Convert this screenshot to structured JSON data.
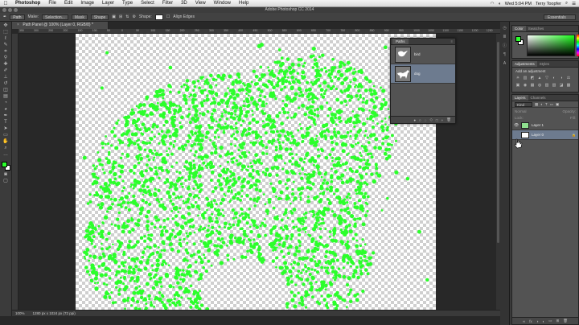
{
  "menubar": {
    "apple": "",
    "app": "Photoshop",
    "items": [
      "File",
      "Edit",
      "Image",
      "Layer",
      "Type",
      "Select",
      "Filter",
      "3D",
      "View",
      "Window",
      "Help"
    ],
    "clock": "Wed 5:04 PM",
    "user": "Terry Toopfer"
  },
  "titlebar": {
    "title": "Adobe Photoshop CC 2014"
  },
  "optionsbar": {
    "mode": "Path",
    "make_label": "Make:",
    "selection_btn": "Selection...",
    "mask_btn": "Mask",
    "shape_btn": "Shape",
    "shape_label": "Shape:",
    "align_edges": "Align Edges",
    "workspace": "Essentials"
  },
  "document": {
    "tab_title": "Path Panel @ 100% (Layer 0, RGB/8) *",
    "close": "×",
    "ruler_ticks": [
      "350",
      "300",
      "250",
      "200",
      "150",
      "100",
      "50",
      "0",
      "50",
      "100",
      "150",
      "200",
      "250",
      "300",
      "350",
      "400",
      "450",
      "500",
      "550",
      "600",
      "650",
      "700",
      "750",
      "800",
      "850",
      "900",
      "950",
      "1000",
      "1050",
      "1100",
      "1150",
      "1200",
      "1250"
    ],
    "zoom": "100%",
    "doc_info": "1280 px x 1024 px (72 ppi)"
  },
  "paths_panel": {
    "tab": "Paths",
    "menu": "≡",
    "paths": [
      {
        "name": "bird",
        "selected": false
      },
      {
        "name": "dog",
        "selected": true
      }
    ],
    "footer_icons": [
      "●",
      "○",
      "◌",
      "◇",
      "□",
      "+",
      "🗑"
    ]
  },
  "color_panel": {
    "tabs": [
      "Color",
      "Swatches"
    ],
    "foreground": "#2bff2b",
    "background": "#ffffff"
  },
  "adjustments_panel": {
    "tabs": [
      "Adjustments",
      "Styles"
    ],
    "title": "Add an adjustment",
    "icons": [
      "☀",
      "▥",
      "◩",
      "▲",
      "▽",
      "◐",
      "◑",
      "⚖",
      "▣",
      "◉",
      "▦",
      "◍",
      "▨",
      "▧",
      "◪",
      "▩"
    ]
  },
  "layers_panel": {
    "tabs": [
      "Layers",
      "Channels"
    ],
    "kind": "Kind",
    "blend": "Normal",
    "opacity": "Opacity:",
    "lock": "Lock:",
    "fill": "Fill:",
    "layers": [
      {
        "name": "Layer 1",
        "thumb": "green",
        "selected": false,
        "eye": "👁"
      },
      {
        "name": "Layer 0",
        "thumb": "white",
        "selected": true,
        "eye": "",
        "lock": "🔒"
      }
    ],
    "footer_icons": [
      "∞",
      "fx",
      "◑",
      "◐",
      "▭",
      "⊞",
      "🗑"
    ]
  },
  "accent": "#2bff2b"
}
